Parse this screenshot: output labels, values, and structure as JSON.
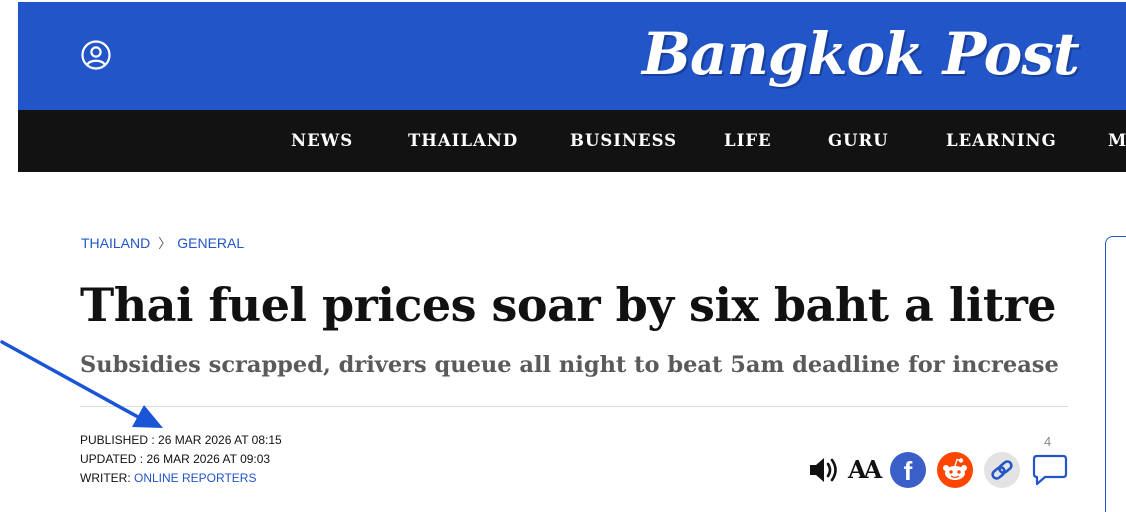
{
  "header": {
    "logo_text": "Bangkok Post",
    "brand_color": "#2255c8",
    "user_icon": "user-circle-icon"
  },
  "nav": {
    "items": [
      {
        "label": "NEWS"
      },
      {
        "label": "THAILAND"
      },
      {
        "label": "BUSINESS"
      },
      {
        "label": "LIFE"
      },
      {
        "label": "GURU"
      },
      {
        "label": "LEARNING"
      },
      {
        "label": "M"
      }
    ]
  },
  "breadcrumb": {
    "section": "THAILAND",
    "separator": "〉",
    "subsection": "GENERAL"
  },
  "article": {
    "headline": "Thai fuel prices soar by six baht a litre",
    "subheadline": "Subsidies scrapped, drivers queue all night to beat 5am deadline for increase",
    "published_label": "PUBLISHED : ",
    "published_value": "26 MAR 2026 AT 08:15",
    "updated_label": "UPDATED : ",
    "updated_value": "26 MAR 2026 AT 09:03",
    "writer_label": "WRITER: ",
    "writer_name": "ONLINE REPORTERS"
  },
  "tools": {
    "listen_icon": "speaker-icon",
    "font_size_label": "AA",
    "facebook_label": "f",
    "facebook_color": "#3b5fc9",
    "reddit_color": "#ff4500",
    "copy_link_icon": "link-icon",
    "comment_icon": "comment-icon",
    "comment_count": "4"
  },
  "annotation": {
    "arrow_color": "#1a55d6"
  }
}
